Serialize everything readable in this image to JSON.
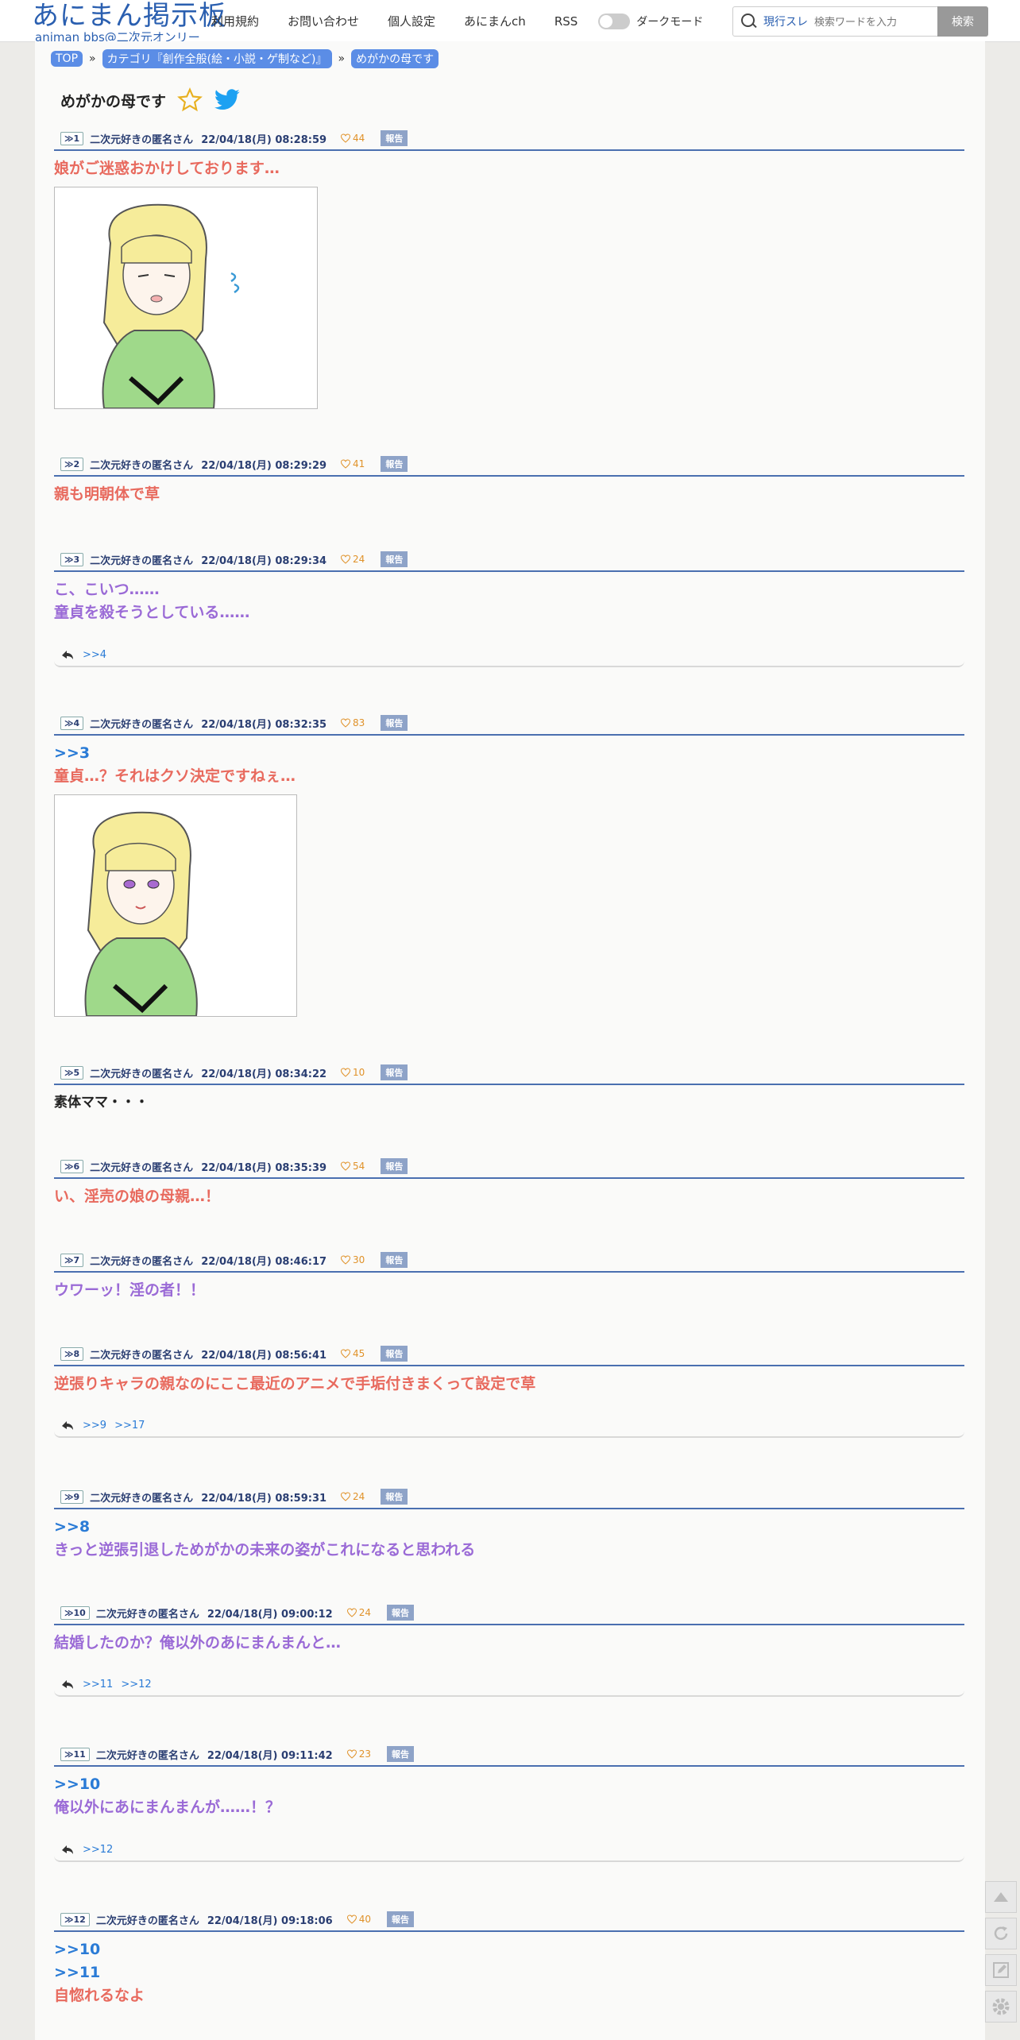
{
  "header": {
    "logo_title": "あにまん掲示板",
    "logo_sub": "animan bbs@二次元オンリー",
    "nav": [
      "利用規約",
      "お問い合わせ",
      "個人設定",
      "あにまんch",
      "RSS"
    ],
    "dark_mode_label": "ダークモード",
    "search_scope": "現行スレ",
    "search_placeholder": "検索ワードを入力",
    "search_button": "検索"
  },
  "breadcrumb": [
    "TOP",
    "カテゴリ『創作全般(絵・小説・ゲ制など)』",
    "めがかの母です"
  ],
  "breadcrumb_sep": "»",
  "thread_title": "めがかの母です",
  "report_label": "報告",
  "colors": {
    "accent": "#2a5fb0",
    "red_text": "#e86a5e",
    "purple_text": "#9a6ad6",
    "anchor": "#2a7bd6",
    "like": "#e0922a"
  },
  "posts": [
    {
      "num": "≫1",
      "name": "二次元好きの匿名さん",
      "date": "22/04/18(月) 08:28:59",
      "likes": "44",
      "lines": [
        "娘がご迷惑おかけしております…"
      ]
    },
    {
      "num": "≫2",
      "name": "二次元好きの匿名さん",
      "date": "22/04/18(月) 08:29:29",
      "likes": "41",
      "lines": [
        "親も明朝体で草"
      ]
    },
    {
      "num": "≫3",
      "name": "二次元好きの匿名さん",
      "date": "22/04/18(月) 08:29:34",
      "likes": "24",
      "lines": [
        "こ、こいつ……",
        "童貞を殺そうとしている……"
      ],
      "replies": [
        ">>4"
      ]
    },
    {
      "num": "≫4",
      "name": "二次元好きの匿名さん",
      "date": "22/04/18(月) 08:32:35",
      "likes": "83",
      "anchors": [
        ">>3"
      ],
      "lines": [
        "童貞…？それはクソ決定ですねぇ…"
      ]
    },
    {
      "num": "≫5",
      "name": "二次元好きの匿名さん",
      "date": "22/04/18(月) 08:34:22",
      "likes": "10",
      "lines": [
        "素体ママ・・・"
      ]
    },
    {
      "num": "≫6",
      "name": "二次元好きの匿名さん",
      "date": "22/04/18(月) 08:35:39",
      "likes": "54",
      "lines": [
        "い、淫売の娘の母親…！"
      ]
    },
    {
      "num": "≫7",
      "name": "二次元好きの匿名さん",
      "date": "22/04/18(月) 08:46:17",
      "likes": "30",
      "lines": [
        "ウワーッ！淫の者！！"
      ]
    },
    {
      "num": "≫8",
      "name": "二次元好きの匿名さん",
      "date": "22/04/18(月) 08:56:41",
      "likes": "45",
      "lines": [
        "逆張りキャラの親なのにここ最近のアニメで手垢付きまくって設定で草"
      ],
      "replies": [
        ">>9",
        ">>17"
      ]
    },
    {
      "num": "≫9",
      "name": "二次元好きの匿名さん",
      "date": "22/04/18(月) 08:59:31",
      "likes": "24",
      "anchors": [
        ">>8"
      ],
      "lines": [
        "きっと逆張引退しためがかの未来の姿がこれになると思われる"
      ]
    },
    {
      "num": "≫10",
      "name": "二次元好きの匿名さん",
      "date": "22/04/18(月) 09:00:12",
      "likes": "24",
      "lines": [
        "結婚したのか？俺以外のあにまんまんと…"
      ],
      "replies": [
        ">>11",
        ">>12"
      ]
    },
    {
      "num": "≫11",
      "name": "二次元好きの匿名さん",
      "date": "22/04/18(月) 09:11:42",
      "likes": "23",
      "anchors": [
        ">>10"
      ],
      "lines": [
        "俺以外にあにまんまんが……！？"
      ],
      "replies": [
        ">>12"
      ]
    },
    {
      "num": "≫12",
      "name": "二次元好きの匿名さん",
      "date": "22/04/18(月) 09:18:06",
      "likes": "40",
      "anchors": [
        ">>10",
        ">>11"
      ],
      "lines": [
        "自惚れるなよ"
      ]
    }
  ]
}
